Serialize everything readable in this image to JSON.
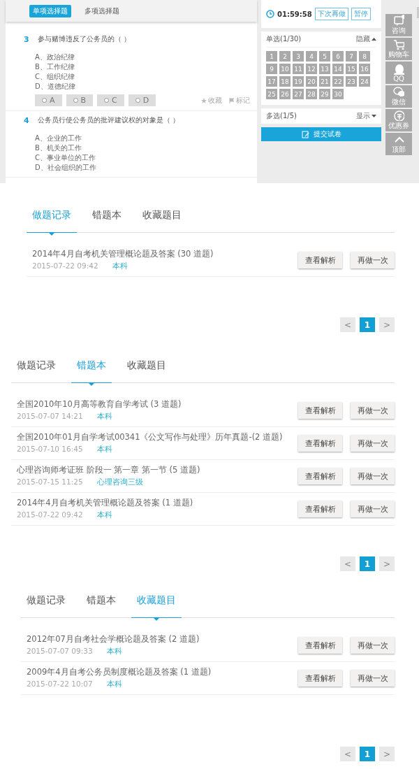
{
  "exam": {
    "type_tabs": [
      {
        "label": "单项选择题",
        "selected": true
      },
      {
        "label": "多项选择题",
        "selected": false
      }
    ],
    "questions": [
      {
        "number": "3",
        "text": "参与赌博违反了公务员的（ ）",
        "options": [
          "A、政治纪律",
          "B、工作纪律",
          "C、组织纪律",
          "D、道德纪律"
        ],
        "answer_buttons": [
          "A",
          "B",
          "C",
          "D"
        ],
        "actions": [
          {
            "kind": "star",
            "label": "收藏"
          },
          {
            "kind": "flag",
            "label": "标记"
          }
        ]
      },
      {
        "number": "4",
        "text": "公务员行使公务员的批评建议权的对象是（ ）",
        "options": [
          "A、企业的工作",
          "B、机关的工作",
          "C、事业单位的工作",
          "D、社会组织的工作"
        ]
      }
    ],
    "timer": {
      "time": "01:59:58",
      "buttons": [
        "下次再做",
        "暂停"
      ]
    },
    "groups": [
      {
        "title": "单选(1/30)",
        "toggle": "隐藏",
        "expanded": true,
        "numbers": [
          "1",
          "2",
          "3",
          "4",
          "5",
          "6",
          "7",
          "8",
          "9",
          "10",
          "11",
          "12",
          "13",
          "14",
          "15",
          "16",
          "17",
          "18",
          "19",
          "20",
          "21",
          "22",
          "23",
          "24",
          "25",
          "26",
          "27",
          "28",
          "29",
          "30"
        ]
      },
      {
        "title": "多选(1/5)",
        "toggle": "显示",
        "expanded": false
      }
    ],
    "submit": "提交试卷",
    "sidebar": [
      {
        "kind": "chat",
        "label": "咨询"
      },
      {
        "kind": "cart",
        "label": "购物车"
      },
      {
        "kind": "qq",
        "label": "QQ"
      },
      {
        "kind": "wechat",
        "label": "微信"
      },
      {
        "kind": "coupon",
        "label": "优惠券"
      },
      {
        "kind": "top",
        "label": "顶部"
      }
    ]
  },
  "records": [
    {
      "tabs": [
        {
          "label": "做题记录",
          "selected": true
        },
        {
          "label": "错题本",
          "selected": false
        },
        {
          "label": "收藏题目",
          "selected": false
        }
      ],
      "rows": [
        {
          "title": "2014年4月自考机关管理概论题及答案 (30 道题)",
          "date": "2015-07-22 09:42",
          "tag": "本科",
          "buttons": [
            "查看解析",
            "再做一次"
          ]
        }
      ],
      "pagination": {
        "prev": "<",
        "pages": [
          {
            "label": "1",
            "selected": true
          }
        ],
        "next": ">"
      }
    },
    {
      "tabs": [
        {
          "label": "做题记录",
          "selected": false
        },
        {
          "label": "错题本",
          "selected": true
        },
        {
          "label": "收藏题目",
          "selected": false
        }
      ],
      "rows": [
        {
          "title": "全国2010年10月高等教育自学考试 (3 道题)",
          "date": "2015-07-07 14:21",
          "tag": "本科",
          "buttons": [
            "查看解析",
            "再做一次"
          ]
        },
        {
          "title": "全国2010年01月自学考试00341《公文写作与处理》历年真题-(2 道题)",
          "date": "2015-07-10 16:45",
          "tag": "本科",
          "buttons": [
            "查看解析",
            "再做一次"
          ]
        },
        {
          "title": "心理咨询师考证班 阶段一 第一章 第一节 (5 道题)",
          "date": "2015-07-15 11:25",
          "tag": "心理咨询三级",
          "buttons": [
            "查看解析",
            "再做一次"
          ]
        },
        {
          "title": "2014年4月自考机关管理概论题及答案 (1 道题)",
          "date": "2015-07-22 09:42",
          "tag": "本科",
          "buttons": [
            "查看解析",
            "再做一次"
          ]
        }
      ],
      "pagination": {
        "prev": "<",
        "pages": [
          {
            "label": "1",
            "selected": true
          }
        ],
        "next": ">"
      }
    },
    {
      "tabs": [
        {
          "label": "做题记录",
          "selected": false
        },
        {
          "label": "错题本",
          "selected": false
        },
        {
          "label": "收藏题目",
          "selected": true
        }
      ],
      "rows": [
        {
          "title": "2012年07月自考社会学概论题及答案 (2 道题)",
          "date": "2015-07-07 09:33",
          "tag": "本科",
          "buttons": [
            "查看解析",
            "再做一次"
          ]
        },
        {
          "title": "2009年4月自考公务员制度概论题及答案 (1 道题)",
          "date": "2015-07-22 10:07",
          "tag": "本科",
          "buttons": [
            "查看解析",
            "再做一次"
          ]
        }
      ],
      "pagination": {
        "prev": "<",
        "pages": [
          {
            "label": "1",
            "selected": true
          }
        ],
        "next": ">"
      }
    }
  ]
}
